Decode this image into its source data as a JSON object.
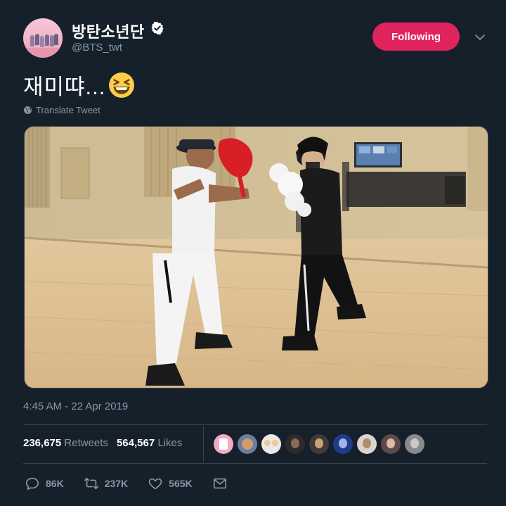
{
  "author": {
    "display_name": "방탄소년단",
    "handle": "@BTS_twt",
    "verified": true,
    "avatar": "group-photo-avatar"
  },
  "follow_button": {
    "label": "Following",
    "color": "#e0245e"
  },
  "menu_icon": "chevron-down-icon",
  "tweet": {
    "text": "재미땨...",
    "emoji": "grinning-squinting-face"
  },
  "translate": {
    "label": "Translate Tweet",
    "icon": "globe-icon"
  },
  "media": {
    "type": "video",
    "description_icon": "video-thumbnail"
  },
  "timestamp": "4:45 AM - 22 Apr 2019",
  "stats": {
    "retweets_count": "236,675",
    "retweets_label": "Retweets",
    "likes_count": "564,567",
    "likes_label": "Likes"
  },
  "liked_by_avatars": [
    "liker-1",
    "liker-2",
    "liker-3",
    "liker-4",
    "liker-5",
    "liker-6",
    "liker-7",
    "liker-8",
    "liker-9"
  ],
  "actions": {
    "reply_count": "86K",
    "retweet_count": "237K",
    "like_count": "565K",
    "message_icon": "envelope-icon"
  },
  "colors": {
    "background": "#15202b",
    "text_secondary": "#8899a6",
    "divider": "#38444d",
    "accent": "#e0245e"
  }
}
